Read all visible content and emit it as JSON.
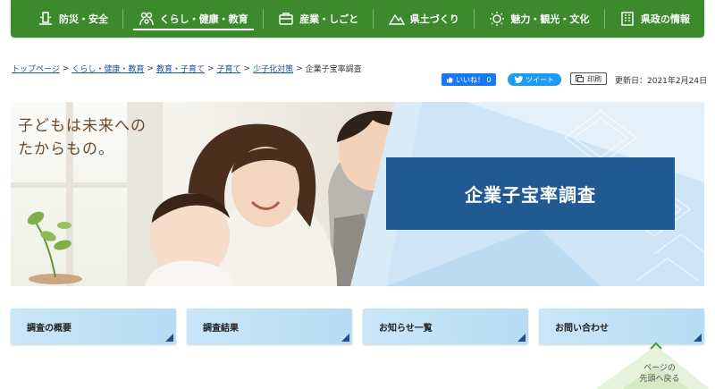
{
  "nav": {
    "items": [
      {
        "label": "防災・安全",
        "icon": "disaster-icon"
      },
      {
        "label": "くらし・健康・教育",
        "icon": "family-icon",
        "active": true
      },
      {
        "label": "産業・しごと",
        "icon": "briefcase-icon"
      },
      {
        "label": "県土づくり",
        "icon": "mountain-icon"
      },
      {
        "label": "魅力・観光・文化",
        "icon": "sparkle-icon"
      },
      {
        "label": "県政の情報",
        "icon": "building-icon"
      }
    ]
  },
  "breadcrumb": {
    "items": [
      "トップページ",
      "くらし・健康・教育",
      "教育・子育て",
      "子育て",
      "少子化対策"
    ],
    "current": "企業子宝率調査",
    "separator": ">"
  },
  "share": {
    "facebook_label": "いいね！ 0",
    "twitter_label": "ツイート",
    "print_label": "印刷"
  },
  "updated": "更新日：2021年2月24日",
  "hero": {
    "tagline_line1": "子どもは未来への",
    "tagline_line2": "たからもの。",
    "title": "企業子宝率調査"
  },
  "cards": [
    {
      "label": "調査の概要"
    },
    {
      "label": "調査結果"
    },
    {
      "label": "お知らせ一覧"
    },
    {
      "label": "お問い合わせ"
    }
  ],
  "back_to_top": {
    "line1": "ページの",
    "line2": "先頭へ戻る"
  },
  "colors": {
    "nav_green": "#3d8a2e",
    "title_blue": "#215a92",
    "card_blue": "#c9e6f8",
    "link_blue": "#1a56a6"
  }
}
